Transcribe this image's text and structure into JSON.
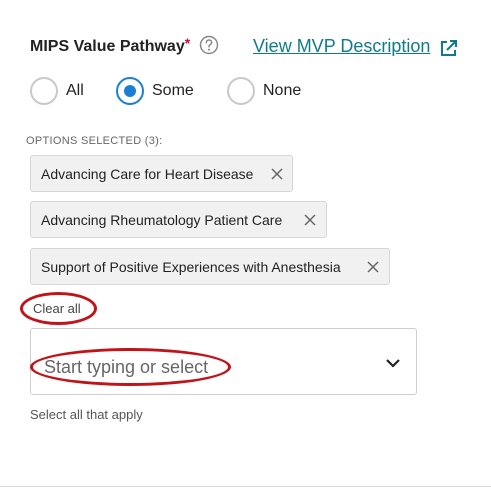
{
  "field": {
    "label": "MIPS Value Pathway",
    "required_mark": "*",
    "help_icon": "question-circle-icon",
    "link_text": "View MVP Description",
    "link_icon": "external-link-icon",
    "link_color": "#0f7b8a"
  },
  "radios": [
    {
      "label": "All",
      "checked": false
    },
    {
      "label": "Some",
      "checked": true
    },
    {
      "label": "None",
      "checked": false
    }
  ],
  "options_header": "OPTIONS SELECTED (3):",
  "chips": [
    {
      "label": "Advancing Care for Heart Disease"
    },
    {
      "label": "Advancing Rheumatology Patient Care"
    },
    {
      "label": "Support of Positive Experiences with Anesthesia"
    }
  ],
  "clear_all": "Clear all",
  "select": {
    "placeholder": "Start typing or select",
    "icon": "chevron-down-icon"
  },
  "hint": "Select all that apply",
  "colors": {
    "accent": "#1a7fd4",
    "annotation": "#c0141b"
  }
}
